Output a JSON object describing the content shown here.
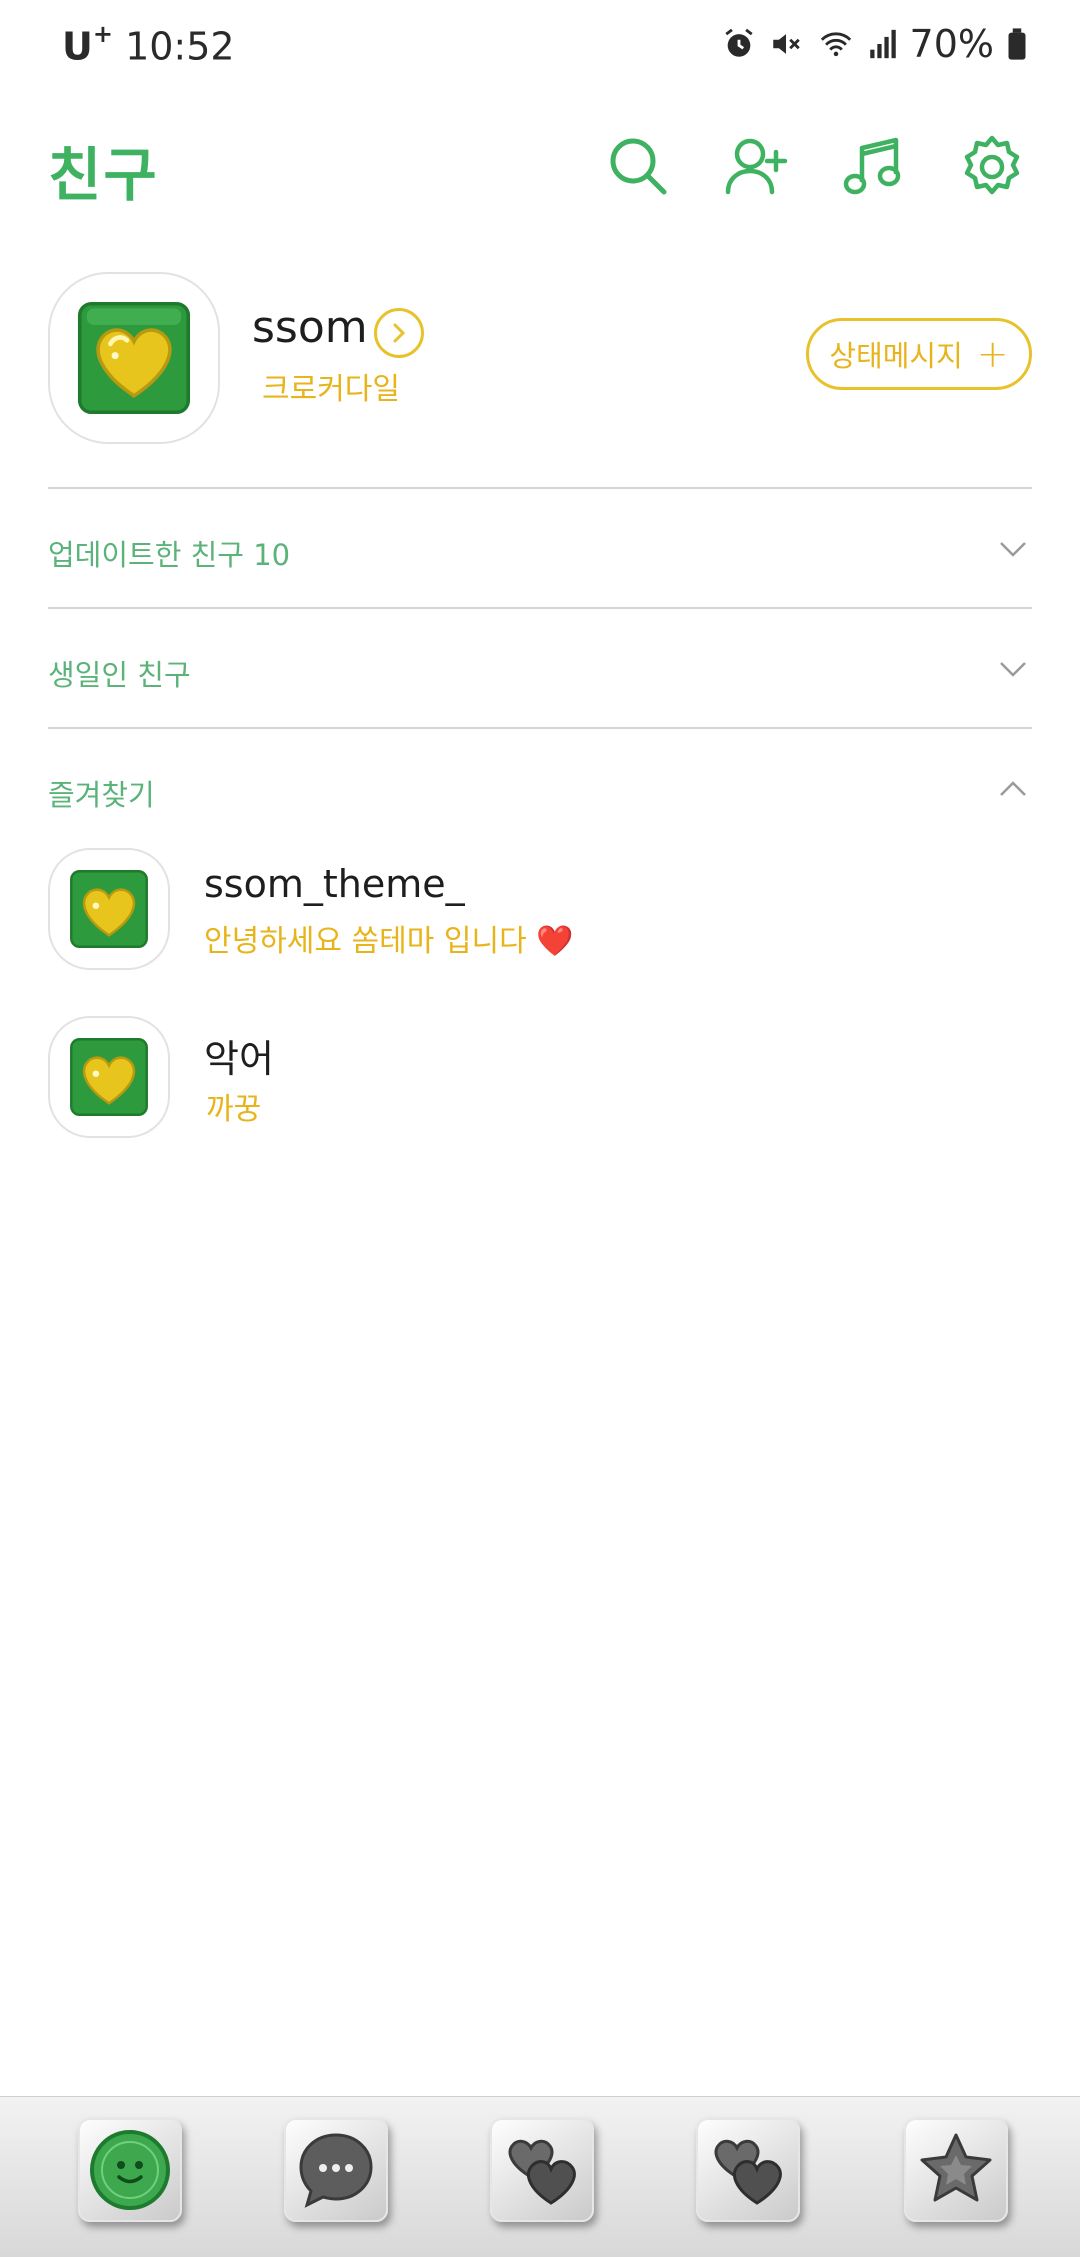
{
  "status_bar": {
    "carrier": "U",
    "carrier_sup": "+",
    "time": "10:52",
    "battery": "70%",
    "icons": [
      "alarm-icon",
      "mute-icon",
      "wifi-icon",
      "signal-icon",
      "battery-icon"
    ]
  },
  "header": {
    "title": "친구",
    "icons": [
      "search-icon",
      "add-friend-icon",
      "music-icon",
      "settings-icon"
    ]
  },
  "profile": {
    "name": "ssom",
    "subtitle": "크로커다일",
    "status_button": "상태메시지",
    "status_button_icon": "+"
  },
  "sections": [
    {
      "label": "업데이트한 친구 10",
      "expanded": false
    },
    {
      "label": "생일인 친구",
      "expanded": false
    },
    {
      "label": "즐겨찾기",
      "expanded": true
    }
  ],
  "favorites": [
    {
      "name": "ssom_theme_",
      "message": "안녕하세요 쏨테마 입니다",
      "emoji": "❤️"
    },
    {
      "name": "악어",
      "message": "까꿍",
      "emoji": ""
    }
  ],
  "tabbar": {
    "tabs": [
      "friends-tab",
      "chats-tab",
      "view-tab",
      "shopping-tab",
      "more-tab"
    ],
    "active_index": 0
  },
  "colors": {
    "accent_green": "#3fb262",
    "accent_yellow": "#e7b41c",
    "section_green": "#5cb37a"
  }
}
